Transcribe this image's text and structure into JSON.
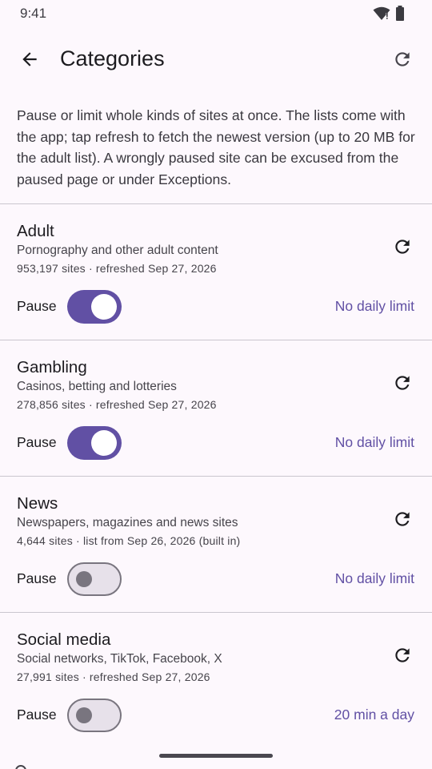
{
  "status_bar": {
    "time": "9:41"
  },
  "app_bar": {
    "title": "Categories"
  },
  "intro": "Pause or limit whole kinds of sites at once. The lists come with the app; tap refresh to fetch the newest version (up to 20 MB for the adult list). A wrongly paused site can be excused from the paused page or under Exceptions.",
  "categories": [
    {
      "title": "Adult",
      "description": "Pornography and other adult content",
      "meta": "953,197 sites · refreshed Sep 27, 2026",
      "pause_label": "Pause",
      "paused": true,
      "limit": "No daily limit"
    },
    {
      "title": "Gambling",
      "description": "Casinos, betting and lotteries",
      "meta": "278,856 sites · refreshed Sep 27, 2026",
      "pause_label": "Pause",
      "paused": true,
      "limit": "No daily limit"
    },
    {
      "title": "News",
      "description": "Newspapers, magazines and news sites",
      "meta": "4,644 sites · list from Sep 26, 2026 (built in)",
      "pause_label": "Pause",
      "paused": false,
      "limit": "No daily limit"
    },
    {
      "title": "Social media",
      "description": "Social networks, TikTok, Facebook, X",
      "meta": "27,991 sites · refreshed Sep 27, 2026",
      "pause_label": "Pause",
      "paused": false,
      "limit": "20 min a day"
    }
  ],
  "colors": {
    "accent": "#6150a4",
    "background": "#fdf8fd",
    "divider": "#cac6cf",
    "switch_off_track": "#e7e1ea",
    "switch_off_outline": "#79757f"
  },
  "icons": {
    "back": "arrow-back-icon",
    "refresh": "refresh-icon",
    "wifi": "wifi-icon",
    "battery": "battery-icon"
  }
}
